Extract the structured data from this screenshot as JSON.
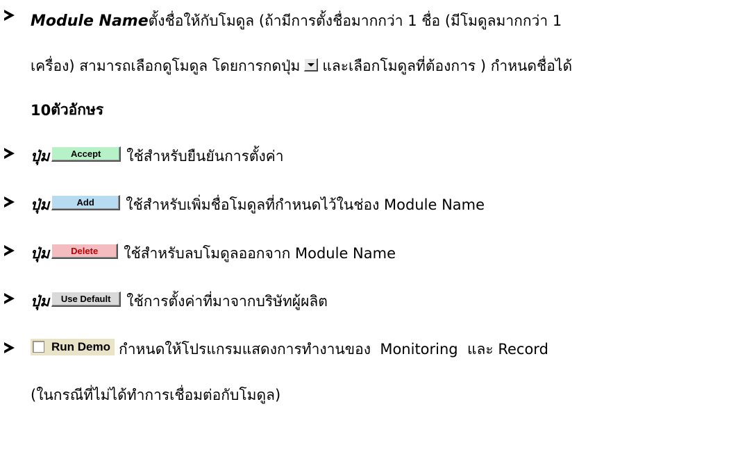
{
  "item1": {
    "term": "Module Name",
    "line1_text": " ตั้งชื่อให้กับโมดูล (ถ้ามีการตั้งชื่อมากกว่า 1 ชื่อ (มีโมดูลมากกว่า 1",
    "line2_before": "เครื่อง) สามารถเลือกดูโมดูล โดยการกดปุ่ม",
    "line2_after": "และเลือกโมดูลที่ต้องการ ) กำหนดชื่อได้",
    "line3_bold": "10",
    "line3_text": " ตัวอักษร"
  },
  "item2": {
    "prefix": "ปุ่ม",
    "button_label": "Accept",
    "text": "ใช้สำหรับยืนยันการตั้งค่า",
    "button_color": "#b6f1c8"
  },
  "item3": {
    "prefix": "ปุ่ม",
    "button_label": "Add",
    "text": "ใช้สำหรับเพิ่มชื่อโมดูลที่กำหนดไว้ในช่อง Module Name",
    "button_color": "#b7dcf2"
  },
  "item4": {
    "prefix": "ปุ่ม",
    "button_label": "Delete",
    "text": "ใช้สำหรับลบโมดูลออกจาก Module Name",
    "button_color": "#f5bcc0"
  },
  "item5": {
    "prefix": "ปุ่ม",
    "button_label": "Use Default",
    "text": "ใช้การตั้งค่าที่มาจากบริษัทผู้ผลิต",
    "button_color": "#d9d9d9"
  },
  "item6": {
    "checkbox_label": "Run Demo",
    "line1_text": "กำหนดให้โปรแกรมแสดงการทำงานของ  Monitoring  และ Record",
    "line2_text": "(ในกรณีที่ไม่ได้ทำการเชื่อมต่อกับโมดูล)"
  },
  "icons": {
    "bullet": "arrowhead-bullet-icon",
    "dropdown": "dropdown-arrow-icon",
    "checkbox": "checkbox-icon"
  }
}
